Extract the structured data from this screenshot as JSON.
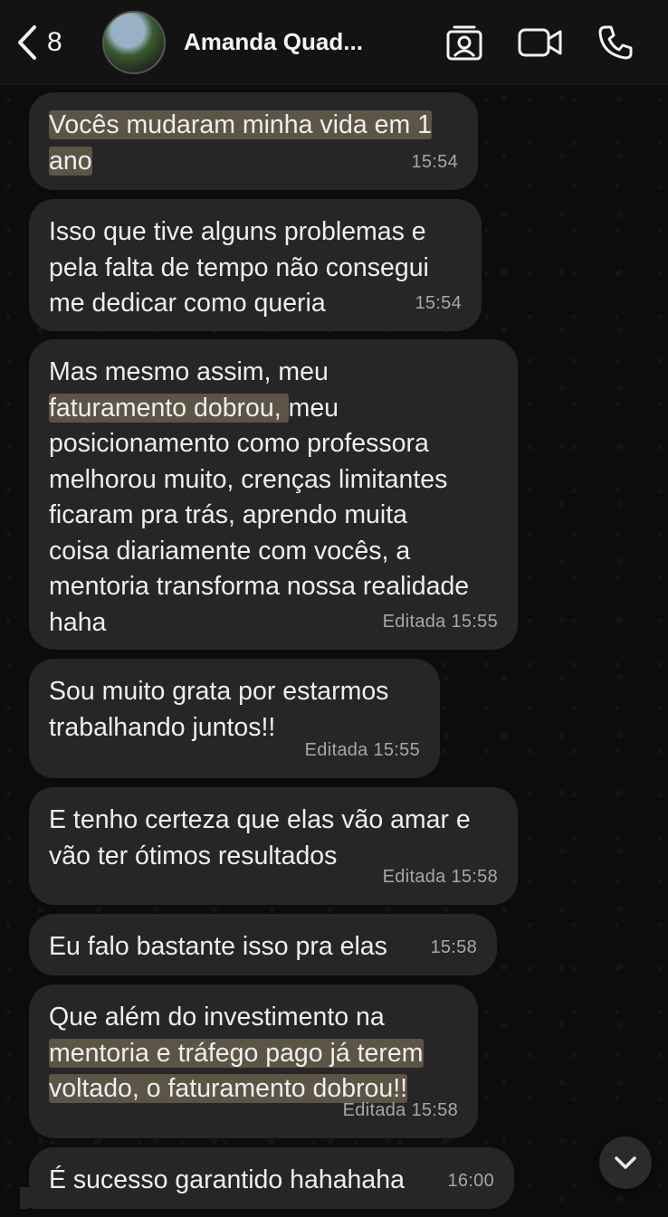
{
  "header": {
    "back_count": "8",
    "contact_name": "Amanda Quad..."
  },
  "messages": [
    {
      "text_lines": [
        "Vocês mudaram minha vida em 1",
        "ano"
      ],
      "time": "15:54",
      "edited": ""
    },
    {
      "text": "Isso que tive alguns problemas e\npela falta de tempo não consegui\nme dedicar como queria",
      "time": "15:54",
      "edited": ""
    },
    {
      "pre": "Mas mesmo assim, meu\n",
      "highlight": "faturamento dobrou, ",
      "post": "meu\nposicionamento como professora\nmelhorou muito, crenças limitantes\nficaram pra trás, aprendo muita\ncoisa diariamente com vocês, a\nmentoria transforma nossa realidade\nhaha",
      "time": "Editada 15:55"
    },
    {
      "text": "Sou muito grata por estarmos\ntrabalhando juntos!!",
      "time": "Editada 15:55"
    },
    {
      "text": "E tenho certeza que elas vão amar e\nvão ter ótimos resultados",
      "time": "Editada 15:58"
    },
    {
      "text": "Eu falo bastante isso pra elas",
      "time": "15:58"
    },
    {
      "pre": "Que além do investimento na\n",
      "highlight_lines": [
        "mentoria e tráfego pago já terem",
        "voltado, o faturamento dobrou!!"
      ],
      "time": "Editada 15:58"
    },
    {
      "text": "É sucesso garantido hahahaha",
      "time": "16:00"
    }
  ]
}
